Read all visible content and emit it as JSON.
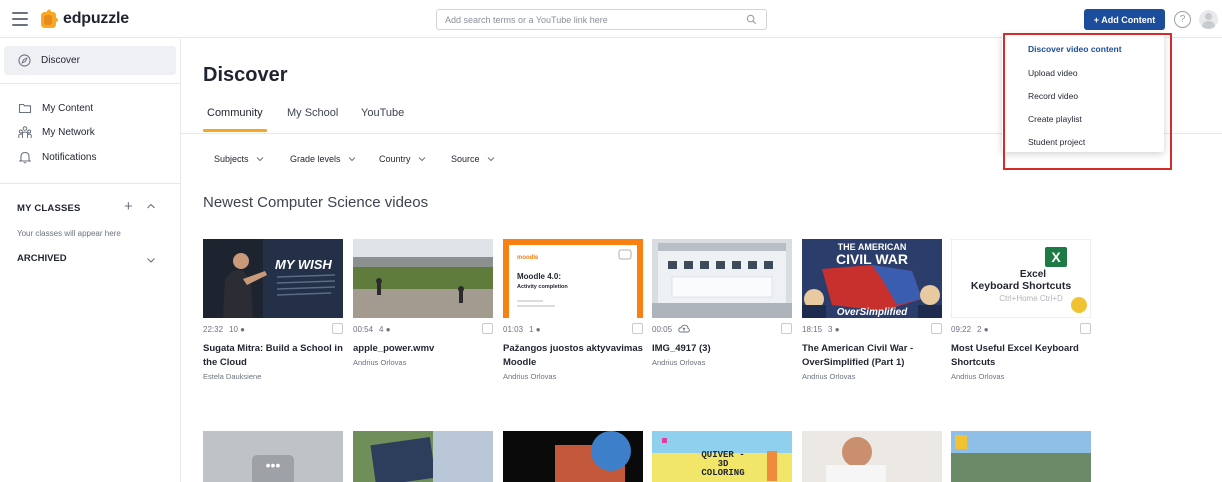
{
  "app": {
    "name": "edpuzzle"
  },
  "search": {
    "placeholder": "Add search terms or a YouTube link here"
  },
  "header": {
    "add_content_label": "+ Add Content",
    "help_label": "?"
  },
  "sidebar": {
    "discover_label": "Discover",
    "items": [
      {
        "label": "My Content",
        "icon": "folder-icon"
      },
      {
        "label": "My Network",
        "icon": "network-icon"
      },
      {
        "label": "Notifications",
        "icon": "bell-icon"
      }
    ],
    "my_classes_label": "MY CLASSES",
    "empty_classes_text": "Your classes will appear here",
    "archived_label": "ARCHIVED"
  },
  "main": {
    "title": "Discover",
    "tabs": [
      {
        "label": "Community",
        "active": true
      },
      {
        "label": "My School",
        "active": false
      },
      {
        "label": "YouTube",
        "active": false
      }
    ],
    "filters": [
      "Subjects",
      "Grade levels",
      "Country",
      "Source"
    ],
    "section_title": "Newest Computer Science videos",
    "videos": [
      {
        "duration": "22:32",
        "count": "10",
        "title": "Sugata Mitra: Build a School in the Cloud",
        "author": "Estela Dauksiene",
        "thumb_text": "MY WISH"
      },
      {
        "duration": "00:54",
        "count": "4",
        "title": "apple_power.wmv",
        "author": "Andrius Orlovas",
        "thumb_text": ""
      },
      {
        "duration": "01:03",
        "count": "1",
        "title": "Pažangos juostos aktyvavimas Moodle",
        "author": "Andrius Orlovas",
        "thumb_text": "Moodle 4.0:",
        "thumb_sub": "Activity completion",
        "thumb_brand": "moodle"
      },
      {
        "duration": "00:05",
        "count": "",
        "title": "IMG_4917 (3)",
        "author": "Andrius Orlovas",
        "thumb_text": ""
      },
      {
        "duration": "18:15",
        "count": "3",
        "title": "The American Civil War - OverSimplified (Part 1)",
        "author": "Andrius Orlovas",
        "thumb_text": "THE AMERICAN",
        "thumb_sub": "CIVIL WAR",
        "thumb_brand": "OverSimplified"
      },
      {
        "duration": "09:22",
        "count": "2",
        "title": "Most Useful Excel Keyboard Shortcuts",
        "author": "Andrius Orlovas",
        "thumb_text": "Excel",
        "thumb_sub": "Keyboard Shortcuts",
        "thumb_brand": "Ctrl+Home  Ctrl+D"
      }
    ],
    "second_row_thumb_text": "QUIVER - 3D COLORING"
  },
  "dropdown": {
    "items": [
      "Discover video content",
      "Upload video",
      "Record video",
      "Create playlist",
      "Student project"
    ],
    "active_index": 0
  },
  "colors": {
    "brand_blue": "#1c4d9c",
    "tab_accent": "#f6a623",
    "highlight_red": "#d62b2b"
  }
}
